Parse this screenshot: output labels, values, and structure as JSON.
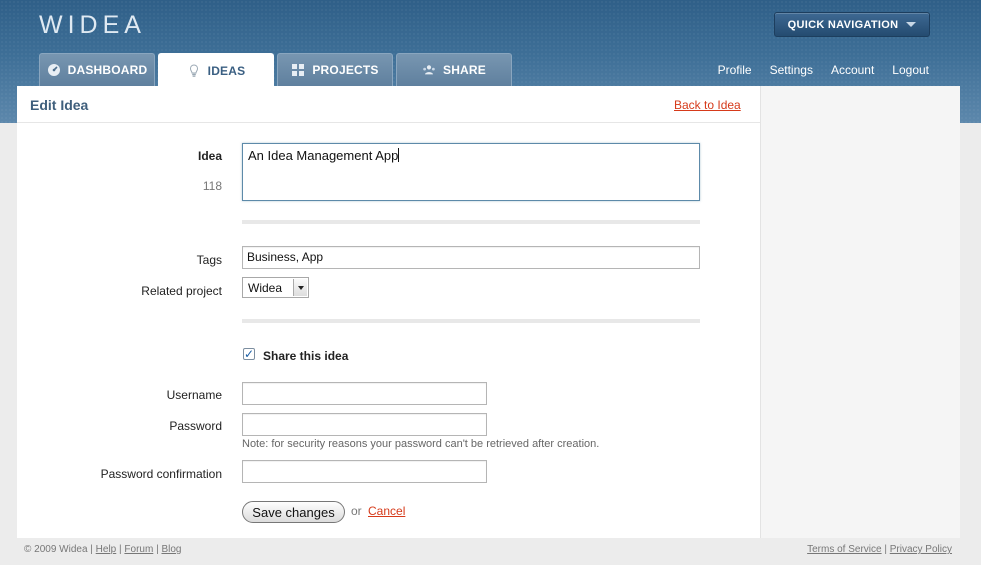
{
  "app": {
    "logo": "WIDEA"
  },
  "header": {
    "quick_nav": "QUICK NAVIGATION",
    "tabs": [
      {
        "label": "DASHBOARD",
        "icon": "dashboard-icon"
      },
      {
        "label": "IDEAS",
        "icon": "lightbulb-icon",
        "active": true
      },
      {
        "label": "PROJECTS",
        "icon": "grid-icon"
      },
      {
        "label": "SHARE",
        "icon": "users-icon"
      }
    ],
    "links": [
      "Profile",
      "Settings",
      "Account",
      "Logout"
    ]
  },
  "page": {
    "title": "Edit Idea",
    "back_link": "Back to Idea"
  },
  "form": {
    "idea_label": "Idea",
    "idea_count": "118",
    "idea_value": "An Idea Management App",
    "tags_label": "Tags",
    "tags_value": "Business, App",
    "project_label": "Related project",
    "project_value": "Widea",
    "share_label": "Share this idea",
    "share_checked": true,
    "username_label": "Username",
    "username_value": "",
    "password_label": "Password",
    "password_value": "",
    "password_note": "Note: for security reasons your password can't be retrieved after creation.",
    "confirm_label": "Password confirmation",
    "confirm_value": "",
    "save_label": "Save changes",
    "or_text": "or",
    "cancel_label": "Cancel"
  },
  "footer": {
    "copyright": "© 2009 Widea",
    "left_links": [
      "Help",
      "Forum",
      "Blog"
    ],
    "right_links": [
      "Terms of Service",
      "Privacy Policy"
    ]
  },
  "colors": {
    "header": "#3e6f97",
    "link": "#d63a1a",
    "title": "#3f5f7c"
  }
}
